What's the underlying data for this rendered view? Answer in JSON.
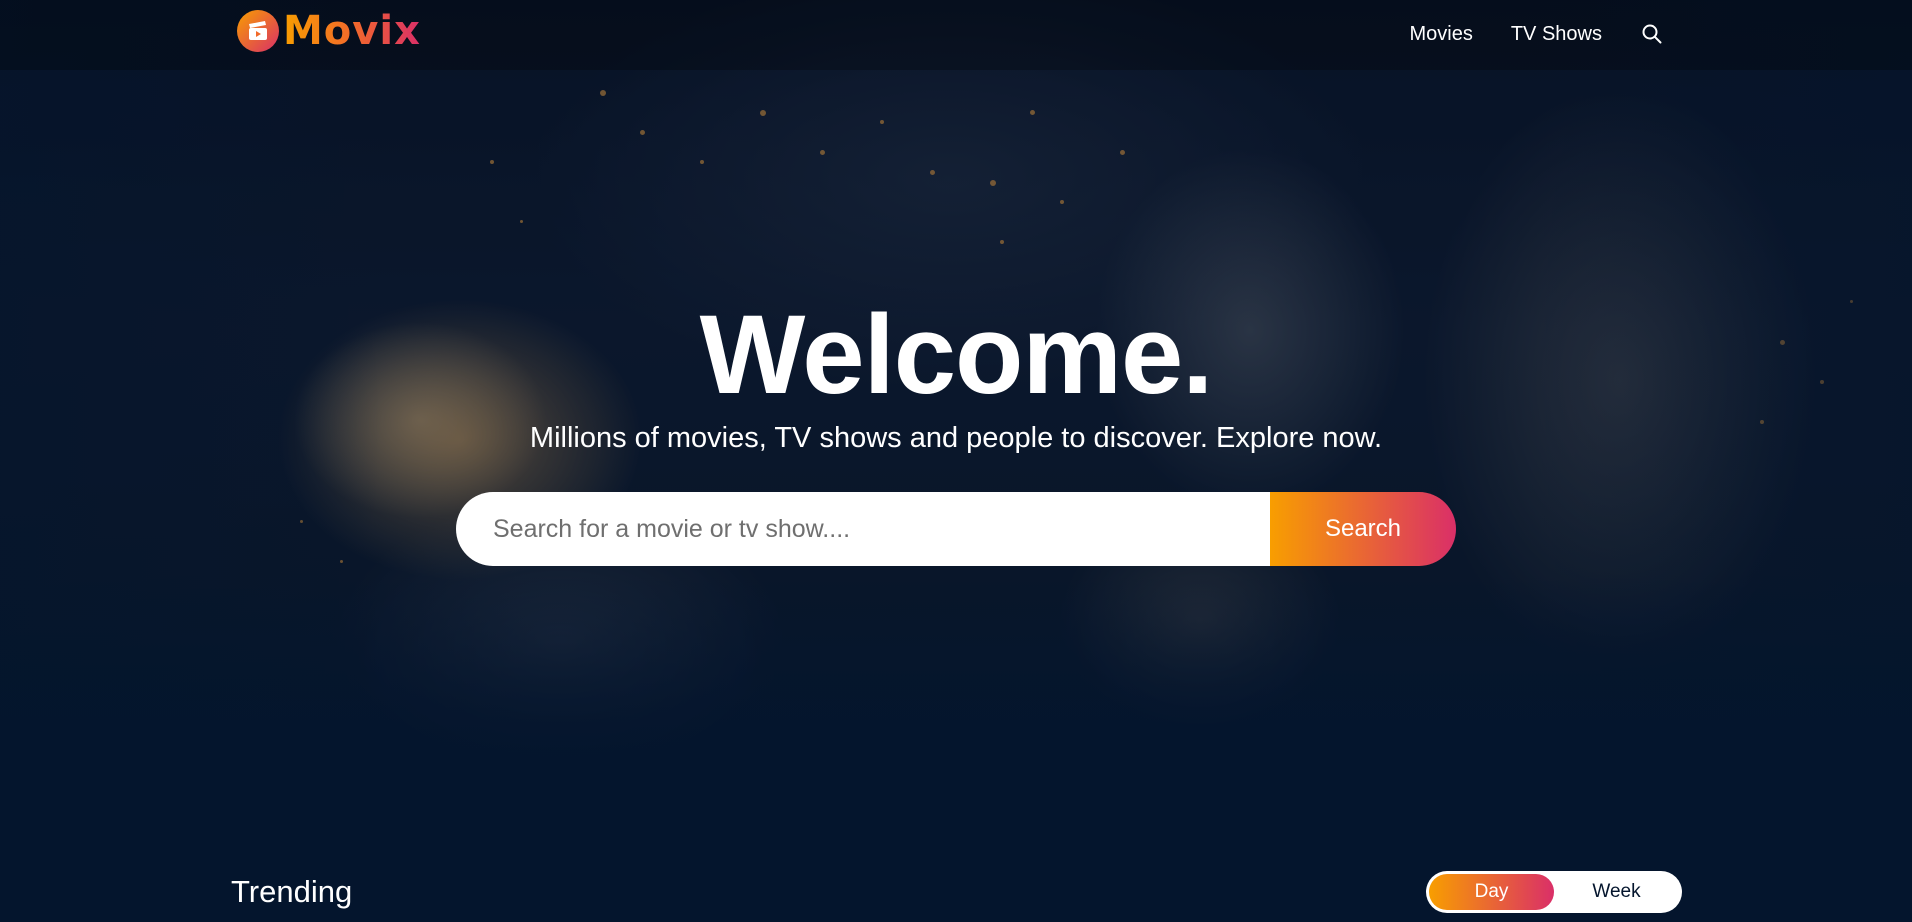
{
  "header": {
    "brand": "Movix",
    "nav": {
      "movies": "Movies",
      "tv_shows": "TV Shows"
    }
  },
  "hero": {
    "title": "Welcome.",
    "subtitle": "Millions of movies, TV shows and people to discover. Explore now.",
    "search": {
      "placeholder": "Search for a movie or tv show....",
      "button_label": "Search"
    }
  },
  "trending": {
    "title": "Trending",
    "tabs": [
      "Day",
      "Week"
    ],
    "active_tab": "Day"
  },
  "colors": {
    "background": "#04152d",
    "accent_start": "#f89e00",
    "accent_end": "#da2f68"
  }
}
